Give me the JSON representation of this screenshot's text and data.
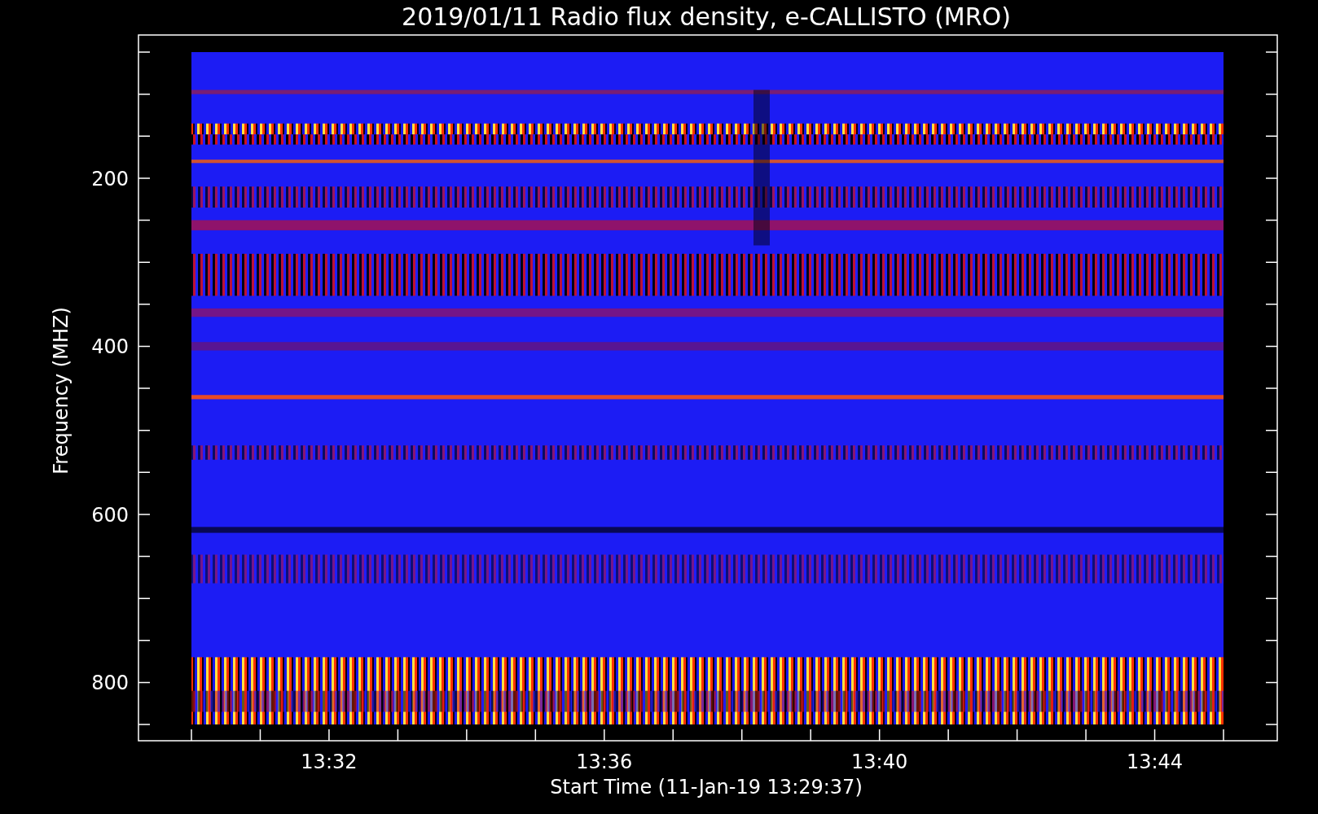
{
  "title": "2019/01/11  Radio flux density, e-CALLISTO (MRO)",
  "ylabel": "Frequency (MHZ)",
  "xlabel": "Start Time (11-Jan-19 13:29:37)",
  "y_ticks": [
    "200",
    "400",
    "600",
    "800"
  ],
  "x_ticks": [
    "13:32",
    "13:36",
    "13:40",
    "13:44"
  ]
}
